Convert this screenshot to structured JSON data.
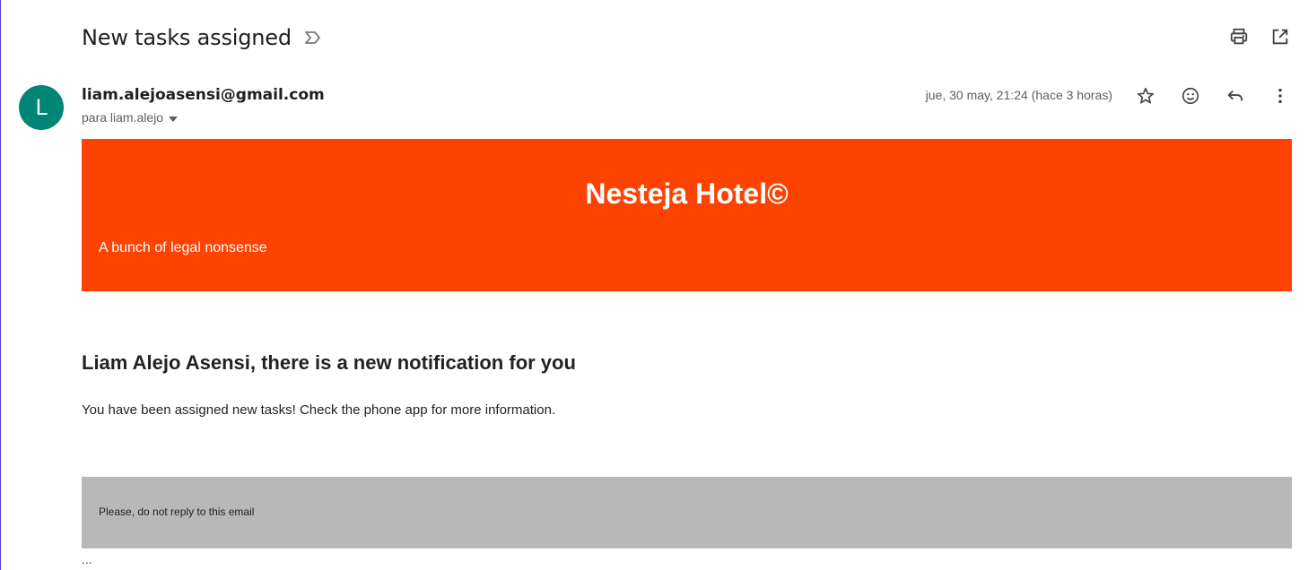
{
  "email": {
    "subject": "New tasks assigned",
    "sender": "liam.alejoasensi@gmail.com",
    "avatar_letter": "L",
    "recipient": "para liam.alejo",
    "date": "jue, 30 may, 21:24 (hace 3 horas)"
  },
  "icons": {
    "label": "label-important-icon",
    "print": "print-icon",
    "open_new_window": "open-in-new-icon",
    "star": "star-icon",
    "emoji": "emoji-icon",
    "reply": "reply-icon",
    "more": "more-vert-icon",
    "recipient_expand": "caret-down-icon"
  },
  "body": {
    "banner_title": "Nesteja Hotel©",
    "banner_subtitle": "A bunch of legal nonsense",
    "heading": "Liam Alejo Asensi, there is a new notification for you",
    "text": "You have been assigned new tasks! Check the phone app for more information.",
    "footer": "Please, do not reply to this email",
    "trimmed_indicator": "..."
  },
  "colors": {
    "banner": "#fc4302",
    "avatar": "#008577",
    "footer_box": "#b8b8b8"
  }
}
